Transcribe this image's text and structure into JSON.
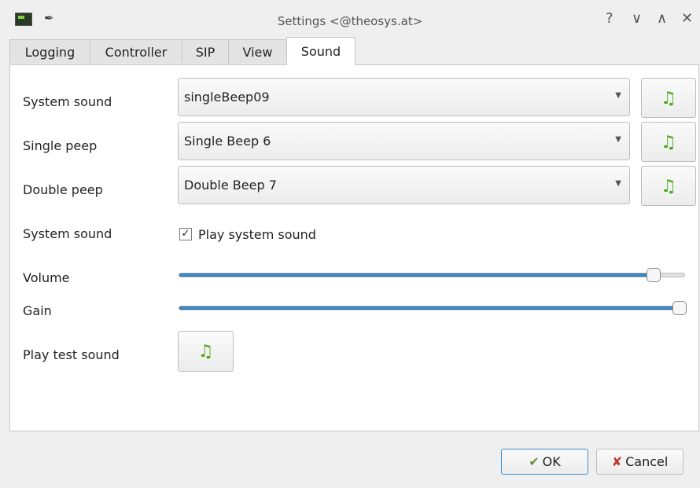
{
  "window": {
    "title": "Settings <@theosys.at>",
    "help": "?",
    "minimize": "∨",
    "maximize": "∧",
    "close": "✕"
  },
  "tabs": [
    "Logging",
    "Controller",
    "SIP",
    "View",
    "Sound"
  ],
  "active_tab": "Sound",
  "rows": [
    {
      "label": "System sound",
      "value": "singleBeep09"
    },
    {
      "label": "Single peep",
      "value": "Single Beep 6"
    },
    {
      "label": "Double peep",
      "value": "Double Beep 7"
    }
  ],
  "system_sound": {
    "label": "System sound",
    "checkbox_label": "Play system sound",
    "checked": true,
    "check_glyph": "✓"
  },
  "volume": {
    "label": "Volume",
    "value_pct": 94
  },
  "gain": {
    "label": "Gain",
    "value_pct": 100
  },
  "test": {
    "label": "Play test sound"
  },
  "icons": {
    "note": "♫",
    "arrow": "▼",
    "pin": "✒",
    "ok": "✔",
    "cancel": "✘"
  },
  "buttons": {
    "ok": "OK",
    "cancel": "Cancel"
  },
  "colors": {
    "accent": "#3d8fd3",
    "note": "#43a812"
  }
}
